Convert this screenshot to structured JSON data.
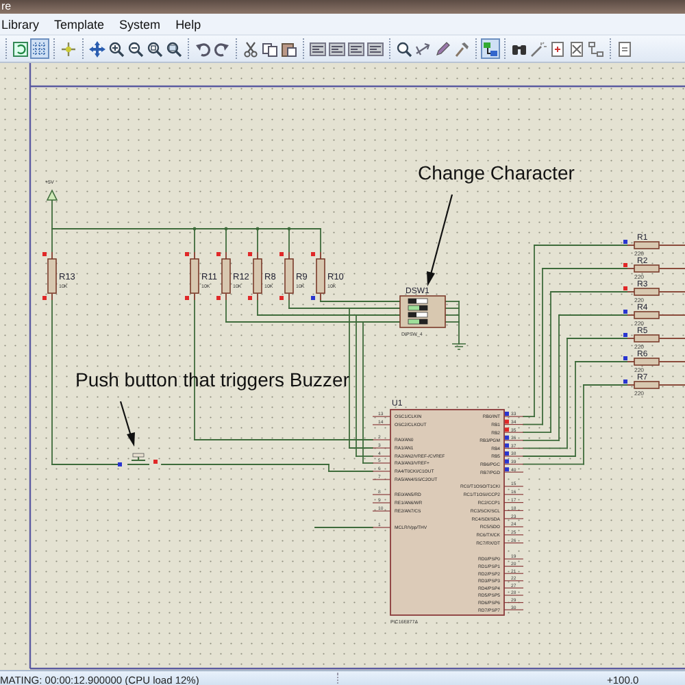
{
  "window": {
    "title": "re"
  },
  "menu": [
    "Library",
    "Template",
    "System",
    "Help"
  ],
  "toolbar": [
    [
      {
        "selected": false
      },
      {
        "selected": true
      }
    ],
    [
      {
        "selected": false
      }
    ],
    [
      {
        "selected": false
      },
      {
        "selected": false
      },
      {
        "selected": false
      },
      {
        "selected": false
      },
      {
        "selected": false
      }
    ],
    [
      {
        "selected": false
      },
      {
        "selected": false
      }
    ],
    [
      {
        "selected": false
      },
      {
        "selected": false
      },
      {
        "selected": false
      }
    ],
    [
      {
        "selected": false
      },
      {
        "selected": false
      },
      {
        "selected": false
      },
      {
        "selected": false
      }
    ],
    [
      {
        "selected": false
      },
      {
        "selected": false
      },
      {
        "selected": false
      },
      {
        "selected": false
      }
    ],
    [
      {
        "selected": true
      }
    ],
    [
      {
        "selected": false
      },
      {
        "selected": false
      },
      {
        "selected": false
      },
      {
        "selected": false
      },
      {
        "selected": false
      }
    ],
    [
      {
        "selected": false
      }
    ]
  ],
  "schematic": {
    "annotations": [
      {
        "text": "Change Character"
      },
      {
        "text": "Push button that triggers Buzzer"
      }
    ],
    "power": {
      "label": "+5V"
    },
    "resistors": [
      {
        "ref": "R13",
        "value": "10K",
        "kind": "vertical",
        "ends": [
          {
            "high": true
          },
          {
            "high": true
          }
        ]
      },
      {
        "ref": "R11",
        "value": "10K",
        "kind": "vertical",
        "ends": [
          {
            "high": true
          },
          {
            "high": true
          }
        ]
      },
      {
        "ref": "R12",
        "value": "10K",
        "kind": "vertical",
        "ends": [
          {
            "high": true
          },
          {
            "high": true
          }
        ]
      },
      {
        "ref": "R8",
        "value": "10K",
        "kind": "vertical",
        "ends": [
          {
            "high": true
          },
          {
            "high": true
          }
        ]
      },
      {
        "ref": "R9",
        "value": "10K",
        "kind": "vertical",
        "ends": [
          {
            "high": true
          },
          {
            "high": true
          }
        ]
      },
      {
        "ref": "R10",
        "value": "10K",
        "kind": "vertical",
        "ends": [
          {
            "high": true
          },
          {
            "high": false
          }
        ]
      },
      {
        "ref": "R1",
        "value": "220",
        "kind": "horizontal",
        "ends": [
          {
            "high": false
          }
        ]
      },
      {
        "ref": "R2",
        "value": "220",
        "kind": "horizontal",
        "ends": [
          {
            "high": true
          }
        ]
      },
      {
        "ref": "R3",
        "value": "220",
        "kind": "horizontal",
        "ends": [
          {
            "high": true
          }
        ]
      },
      {
        "ref": "R4",
        "value": "220",
        "kind": "horizontal",
        "ends": [
          {
            "high": false
          }
        ]
      },
      {
        "ref": "R5",
        "value": "220",
        "kind": "horizontal",
        "ends": [
          {
            "high": false
          }
        ]
      },
      {
        "ref": "R6",
        "value": "220",
        "kind": "horizontal",
        "ends": [
          {
            "high": false
          }
        ]
      },
      {
        "ref": "R7",
        "value": "220",
        "kind": "horizontal",
        "ends": [
          {
            "high": false
          }
        ]
      }
    ],
    "switch": {
      "ref": "DSW1",
      "type": "DIPSW_4",
      "switches": [
        {
          "on": false
        },
        {
          "on": true
        },
        {
          "on": false
        },
        {
          "on": true
        }
      ]
    },
    "button": {
      "ends": [
        {
          "high": false
        },
        {
          "high": true
        }
      ]
    },
    "chip": {
      "ref": "U1",
      "part": "PIC16F877A",
      "left_pins": [
        [
          {
            "name": "OSC1/CLKIN",
            "number": "13"
          },
          {
            "name": "OSC2/CLKOUT",
            "number": "14"
          }
        ],
        [
          {
            "name": "RA0/AN0",
            "number": "2"
          },
          {
            "name": "RA1/AN1",
            "number": "3"
          },
          {
            "name": "RA2/AN2/VREF-/CVREF",
            "number": "4"
          },
          {
            "name": "RA3/AN3/VREF+",
            "number": "5"
          },
          {
            "name": "RA4/T0CKI/C1OUT",
            "number": "6"
          },
          {
            "name": "RA5/AN4/SS/C2OUT",
            "number": "7"
          }
        ],
        [
          {
            "name": "RE0/AN5/RD",
            "number": "8"
          },
          {
            "name": "RE1/AN6/WR",
            "number": "9"
          },
          {
            "name": "RE2/AN7/CS",
            "number": "10"
          }
        ],
        [
          {
            "name": "MCLR/Vpp/THV",
            "number": "1"
          }
        ]
      ],
      "right_pins": [
        [
          {
            "name": "RB0/INT",
            "number": "33",
            "high": false
          },
          {
            "name": "RB1",
            "number": "34",
            "high": true
          },
          {
            "name": "RB2",
            "number": "35",
            "high": true
          },
          {
            "name": "RB3/PGM",
            "number": "36",
            "high": false
          },
          {
            "name": "RB4",
            "number": "37",
            "high": false
          },
          {
            "name": "RB5",
            "number": "38",
            "high": false
          },
          {
            "name": "RB6/PGC",
            "number": "39",
            "high": false
          },
          {
            "name": "RB7/PGD",
            "number": "40",
            "high": false
          }
        ],
        [
          {
            "name": "RC0/T1OSO/T1CKI",
            "number": "15"
          },
          {
            "name": "RC1/T1OSI/CCP2",
            "number": "16"
          },
          {
            "name": "RC2/CCP1",
            "number": "17"
          },
          {
            "name": "RC3/SCK/SCL",
            "number": "18"
          },
          {
            "name": "RC4/SDI/SDA",
            "number": "23"
          },
          {
            "name": "RC5/SDO",
            "number": "24"
          },
          {
            "name": "RC6/TX/CK",
            "number": "25"
          },
          {
            "name": "RC7/RX/DT",
            "number": "26"
          }
        ],
        [
          {
            "name": "RD0/PSP0",
            "number": "19"
          },
          {
            "name": "RD1/PSP1",
            "number": "20"
          },
          {
            "name": "RD2/PSP2",
            "number": "21"
          },
          {
            "name": "RD3/PSP3",
            "number": "22"
          },
          {
            "name": "RD4/PSP4",
            "number": "27"
          },
          {
            "name": "RD5/PSP5",
            "number": "28"
          },
          {
            "name": "RD6/PSP6",
            "number": "29"
          },
          {
            "name": "RD7/PSP7",
            "number": "30"
          }
        ]
      ]
    }
  },
  "status_bar": {
    "message": "MATING: 00:00:12.900000 (CPU load 12%)",
    "zoom": "+100.0"
  }
}
